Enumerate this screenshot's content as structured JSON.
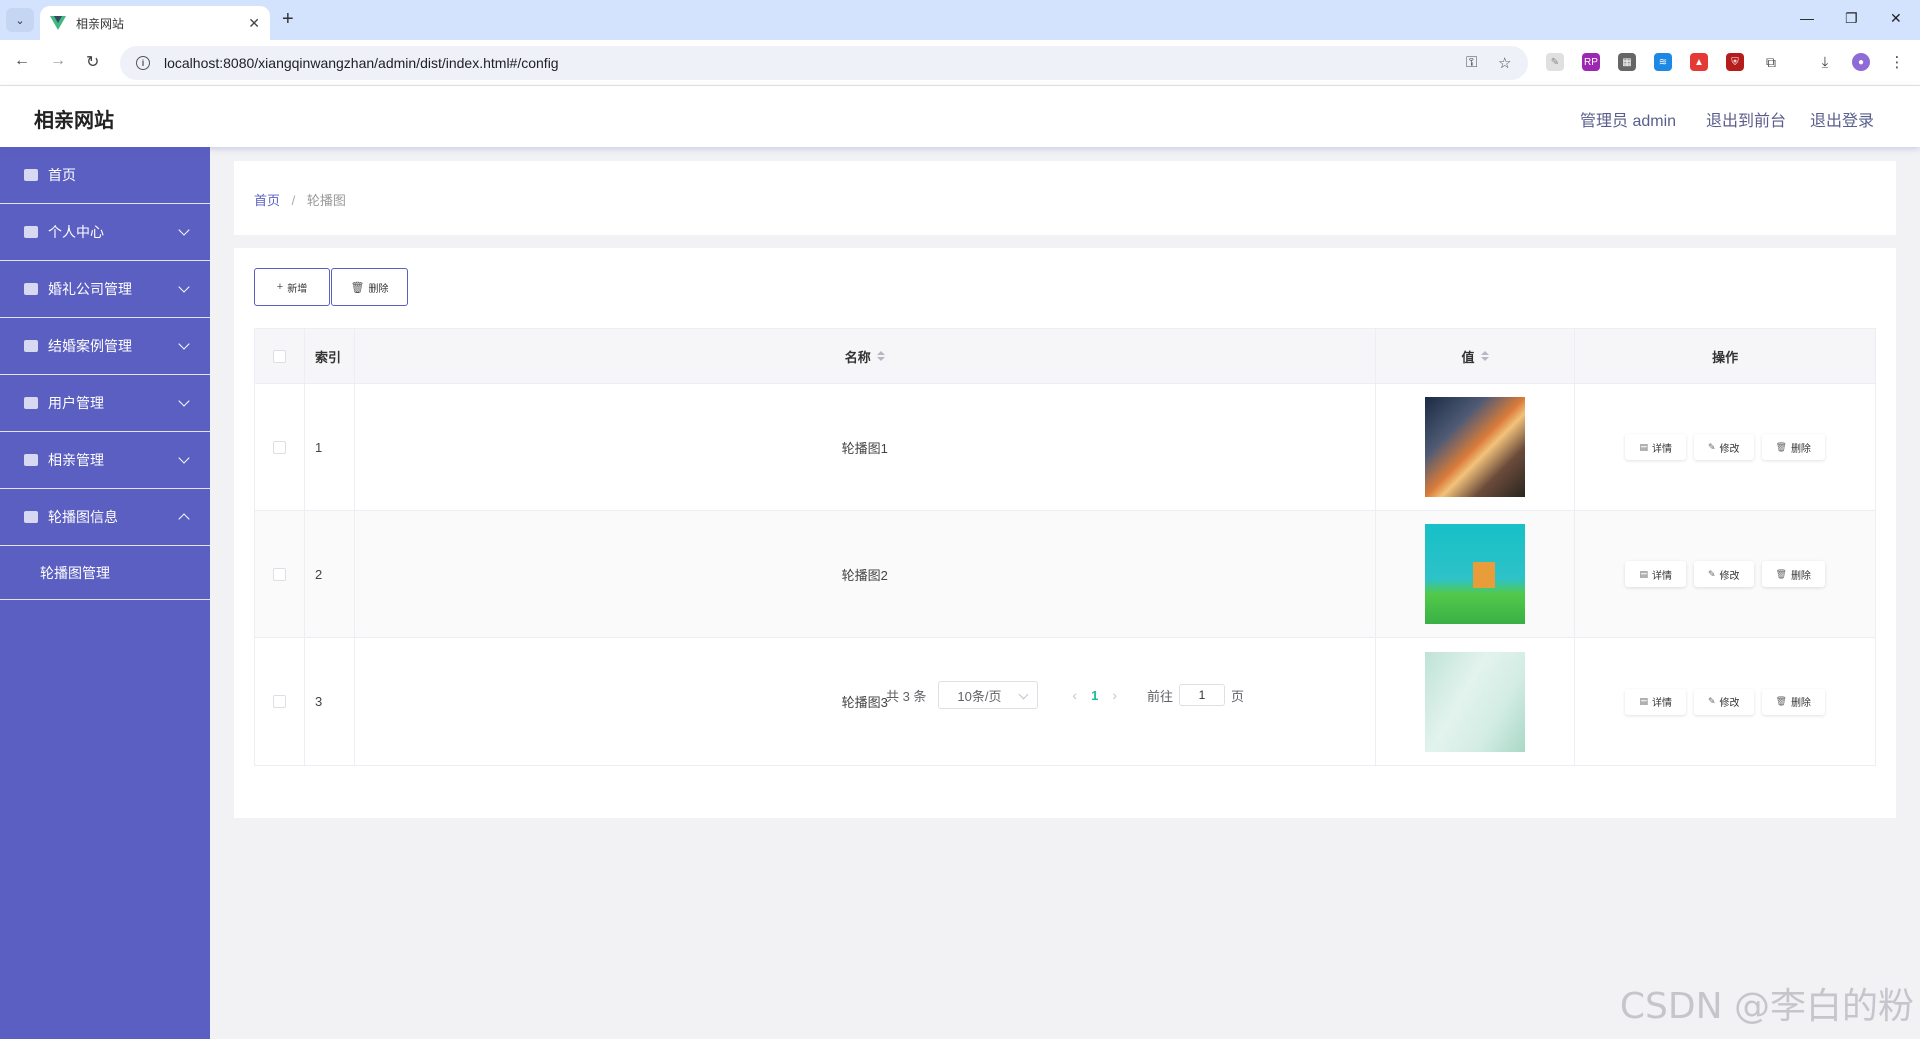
{
  "browser": {
    "tab_title": "相亲网站",
    "url": "localhost:8080/xiangqinwangzhan/admin/dist/index.html#/config"
  },
  "header": {
    "site_title": "相亲网站",
    "admin_label": "管理员 admin",
    "back_to_front": "退出到前台",
    "logout": "退出登录"
  },
  "sidebar": {
    "items": [
      {
        "label": "首页",
        "icon": "home-icon"
      },
      {
        "label": "个人中心",
        "icon": "user-icon"
      },
      {
        "label": "婚礼公司管理",
        "icon": "briefcase-icon"
      },
      {
        "label": "结婚案例管理",
        "icon": "clipboard-icon"
      },
      {
        "label": "用户管理",
        "icon": "user-card-icon"
      },
      {
        "label": "相亲管理",
        "icon": "clipboard-check-icon"
      },
      {
        "label": "轮播图信息",
        "icon": "menu-icon"
      }
    ],
    "submenu": [
      {
        "label": "轮播图管理"
      }
    ]
  },
  "breadcrumb": {
    "home": "首页",
    "separator": "/",
    "current": "轮播图"
  },
  "toolbar": {
    "add_label": "新增",
    "delete_label": "删除"
  },
  "table": {
    "headers": {
      "index": "索引",
      "name": "名称",
      "value": "值",
      "actions": "操作"
    },
    "rows": [
      {
        "index": "1",
        "name": "轮播图1",
        "image": "city-night-traffic"
      },
      {
        "index": "2",
        "name": "轮播图2",
        "image": "cartoon-green-hill"
      },
      {
        "index": "3",
        "name": "轮播图3",
        "image": "pale-green-floral"
      }
    ],
    "actions": {
      "detail": "详情",
      "edit": "修改",
      "delete": "删除"
    }
  },
  "pagination": {
    "total": "共 3 条",
    "page_size": "10条/页",
    "current_page": "1",
    "goto_label": "前往",
    "goto_value": "1",
    "page_suffix": "页"
  },
  "watermark": "CSDN @李白的粉",
  "colors": {
    "sidebar_bg": "#5b5fc1",
    "accent": "#5b5fc1",
    "active_page": "#1abc9c"
  }
}
